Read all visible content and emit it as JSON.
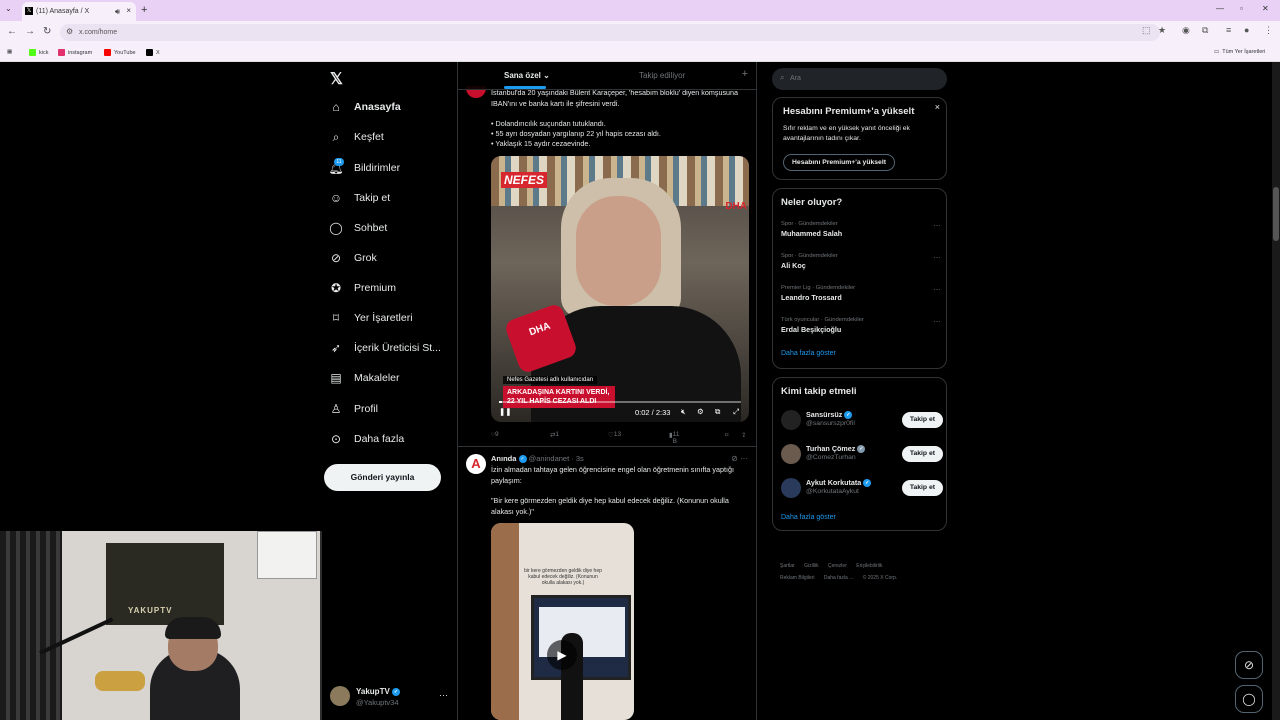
{
  "browser": {
    "tab_title": "(11) Anasayfa / X",
    "url": "x.com/home",
    "bookmarks": [
      {
        "label": "kick",
        "color": "#53fc18"
      },
      {
        "label": "instagram",
        "color": "#e1306c"
      },
      {
        "label": "YouTube",
        "color": "#ff0000"
      },
      {
        "label": "X",
        "color": "#000000"
      }
    ],
    "all_bookmarks": "Tüm Yer İşaretleri"
  },
  "nav": {
    "items": [
      {
        "label": "Anasayfa",
        "icon": "home-icon"
      },
      {
        "label": "Keşfet",
        "icon": "search-icon"
      },
      {
        "label": "Bildirimler",
        "icon": "bell-icon"
      },
      {
        "label": "Takip et",
        "icon": "person-add-icon"
      },
      {
        "label": "Sohbet",
        "icon": "chat-icon"
      },
      {
        "label": "Grok",
        "icon": "grok-icon"
      },
      {
        "label": "Premium",
        "icon": "premium-icon"
      },
      {
        "label": "Yer İşaretleri",
        "icon": "bookmark-icon"
      },
      {
        "label": "İçerik Üreticisi St...",
        "icon": "rocket-icon"
      },
      {
        "label": "Makaleler",
        "icon": "article-icon"
      },
      {
        "label": "Profil",
        "icon": "profile-icon"
      },
      {
        "label": "Daha fazla",
        "icon": "more-icon"
      }
    ],
    "notif_count": "11",
    "post_button": "Gönderi yayınla"
  },
  "account": {
    "name": "YakupTV",
    "handle": "@Yakuptv34"
  },
  "webcam": {
    "poster_text": "YAKUPTV"
  },
  "feed": {
    "tabs": [
      "Sana özel",
      "Takip ediliyor"
    ],
    "tweet1": {
      "text_top": "İstanbul'da 20 yaşındaki Bülent Karaçeper, 'hesabım bloklu' diyen komşusuna IBAN'ını ve banka kartı ile şifresini verdi.",
      "bullets": [
        "• Dolandırıcılık suçundan tutuklandı.",
        "• 55 ayrı dosyadan yargılanıp 22 yıl hapis cezası aldı.",
        "• Yaklaşık 15 aydır cezaevinde."
      ],
      "video_logo": "NEFES",
      "video_dha": "DHA",
      "mic_text": "DHA",
      "caption_small": "Nefes Gazetesi adlı kullanıcıdan",
      "caption_red": "ARKADAŞINA KARTINI VERDİ, 22 YIL HAPİS CEZASI ALDI",
      "time": "0:02 / 2:33",
      "progress": 0.013,
      "replies": "9",
      "reposts": "1",
      "likes": "13",
      "views": "11 B"
    },
    "tweet2": {
      "avatar_letter": "A",
      "name": "Anında",
      "handle": "@anindanet",
      "time": "3s",
      "text1": "İzin almadan tahtaya gelen öğrencisine engel olan öğretmenin sınıfta yaptığı paylaşım:",
      "text2": "\"Bir kere görmezden geldik diye hep kabul edecek değiliz. (Konunun okulla alakası yok.)\"",
      "video_caption": "bir kere görmezden geldik diye hep kabul edecek değiliz. (Konunun okulla alakası yok.)"
    }
  },
  "right": {
    "search_placeholder": "Ara",
    "premium": {
      "title": "Hesabını Premium+'a yükselt",
      "text": "Sıfır reklam ve en yüksek yanıt önceliği ek avantajlarının tadını çıkar.",
      "button": "Hesabını Premium+'a yükselt"
    },
    "trends_title": "Neler oluyor?",
    "trends": [
      {
        "context": "Spor · Gündemdekiler",
        "title": "Muhammed Salah"
      },
      {
        "context": "Spor · Gündemdekiler",
        "title": "Ali Koç"
      },
      {
        "context": "Premier Lig · Gündemdekiler",
        "title": "Leandro Trossard"
      },
      {
        "context": "Türk oyuncular · Gündemdekiler",
        "title": "Erdal Beşikçioğlu"
      }
    ],
    "show_more": "Daha fazla göster",
    "who_title": "Kimi takip etmeli",
    "who": [
      {
        "name": "Sansürsüz",
        "handle": "@sansurszpr0fil",
        "color": "#222222",
        "badge": "blue"
      },
      {
        "name": "Turhan Çömez",
        "handle": "@ComezTurhan",
        "color": "#6b5a4e",
        "badge": "gray"
      },
      {
        "name": "Aykut Korkutata",
        "handle": "@KorkutataAykut",
        "color": "#2a3a5a",
        "badge": "blue"
      }
    ],
    "follow_label": "Takip et",
    "footer": [
      "Şartlar",
      "Gizlilik",
      "Çerezler",
      "Erişilebilirlik",
      "Reklam Bilgileri",
      "Daha fazla ...",
      "© 2025 X Corp."
    ]
  }
}
